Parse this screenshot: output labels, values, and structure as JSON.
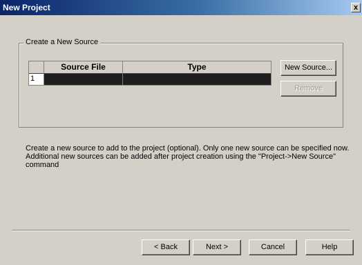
{
  "window": {
    "title": "New Project",
    "close_label": "x"
  },
  "group": {
    "legend": "Create a New Source"
  },
  "table": {
    "columns": [
      "Source File",
      "Type"
    ],
    "rows": [
      {
        "index": "1",
        "source_file": "",
        "type": ""
      }
    ]
  },
  "buttons": {
    "new_source": "New Source...",
    "remove": "Remove",
    "back": "< Back",
    "next": "Next >",
    "cancel": "Cancel",
    "help": "Help"
  },
  "description": {
    "line1": "Create a new source to add to the project (optional). Only one new source can be specified now.",
    "line2": "Additional new sources can be added after project creation using the \"Project->New Source\"",
    "line3": "command"
  }
}
